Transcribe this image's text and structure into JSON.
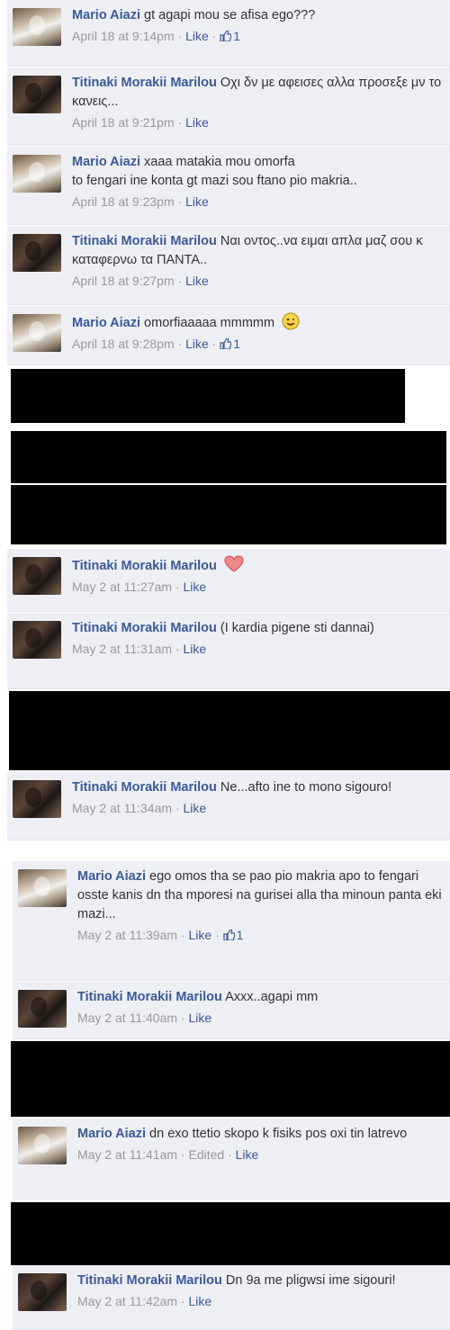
{
  "comments": [
    {
      "author": "Mario Aiazi",
      "text": "gt agapi mou se afisa ego???",
      "date": "April 18 at 9:14pm",
      "like": "Like",
      "likes": "1"
    },
    {
      "author": "Titinaki Morakii Marilou",
      "text": "Οχι δν με αφεισες αλλα προσεξε μν το κανεις...",
      "date": "April 18 at 9:21pm",
      "like": "Like"
    },
    {
      "author": "Mario Aiazi",
      "text": "xaaa matakia mou omorfa",
      "text2": "to fengari ine konta gt mazi sou ftano pio makria..",
      "date": "April 18 at 9:23pm",
      "like": "Like"
    },
    {
      "author": "Titinaki Morakii Marilou",
      "text": "Ναι οντος..να ειμαι απλα μαζ σου κ καταφερνω τα ΠΑΝΤΑ..",
      "date": "April 18 at 9:27pm",
      "like": "Like"
    },
    {
      "author": "Mario Aiazi",
      "text": "omorfiaaaaa mmmmm",
      "date": "April 18 at 9:28pm",
      "like": "Like",
      "likes": "1"
    },
    {
      "author": "Titinaki Morakii Marilou",
      "text": "",
      "date": "May 2 at 11:27am",
      "like": "Like"
    },
    {
      "author": "Titinaki Morakii Marilou",
      "text": "(I kardia pigene sti dannai)",
      "date": "May 2 at 11:31am",
      "like": "Like"
    },
    {
      "author": "Titinaki Morakii Marilou",
      "text": "Ne...afto ine to mono sigouro!",
      "date": "May 2 at 11:34am",
      "like": "Like"
    },
    {
      "author": "Mario Aiazi",
      "text": "ego omos tha se pao pio makria apo to fengari",
      "text2": "osste kanis dn tha mporesi na gurisei alla tha minoun panta eki mazi...",
      "date": "May 2 at 11:39am",
      "like": "Like",
      "likes": "1"
    },
    {
      "author": "Titinaki Morakii Marilou",
      "text": "Axxx..agapi mm",
      "date": "May 2 at 11:40am",
      "like": "Like"
    },
    {
      "author": "Mario Aiazi",
      "text": "dn exo ttetio skopo k fisiks pos oxi tin latrevo",
      "date": "May 2 at 11:41am",
      "edited": "Edited",
      "like": "Like"
    },
    {
      "author": "Titinaki Morakii Marilou",
      "text": "Dn 9a me pligwsi ime sigouri!",
      "date": "May 2 at 11:42am",
      "like": "Like"
    }
  ],
  "separator": "·",
  "colors": {
    "link": "#3b5998",
    "meta": "#999999",
    "row_bg": "#edeff4",
    "redaction": "#000000"
  }
}
